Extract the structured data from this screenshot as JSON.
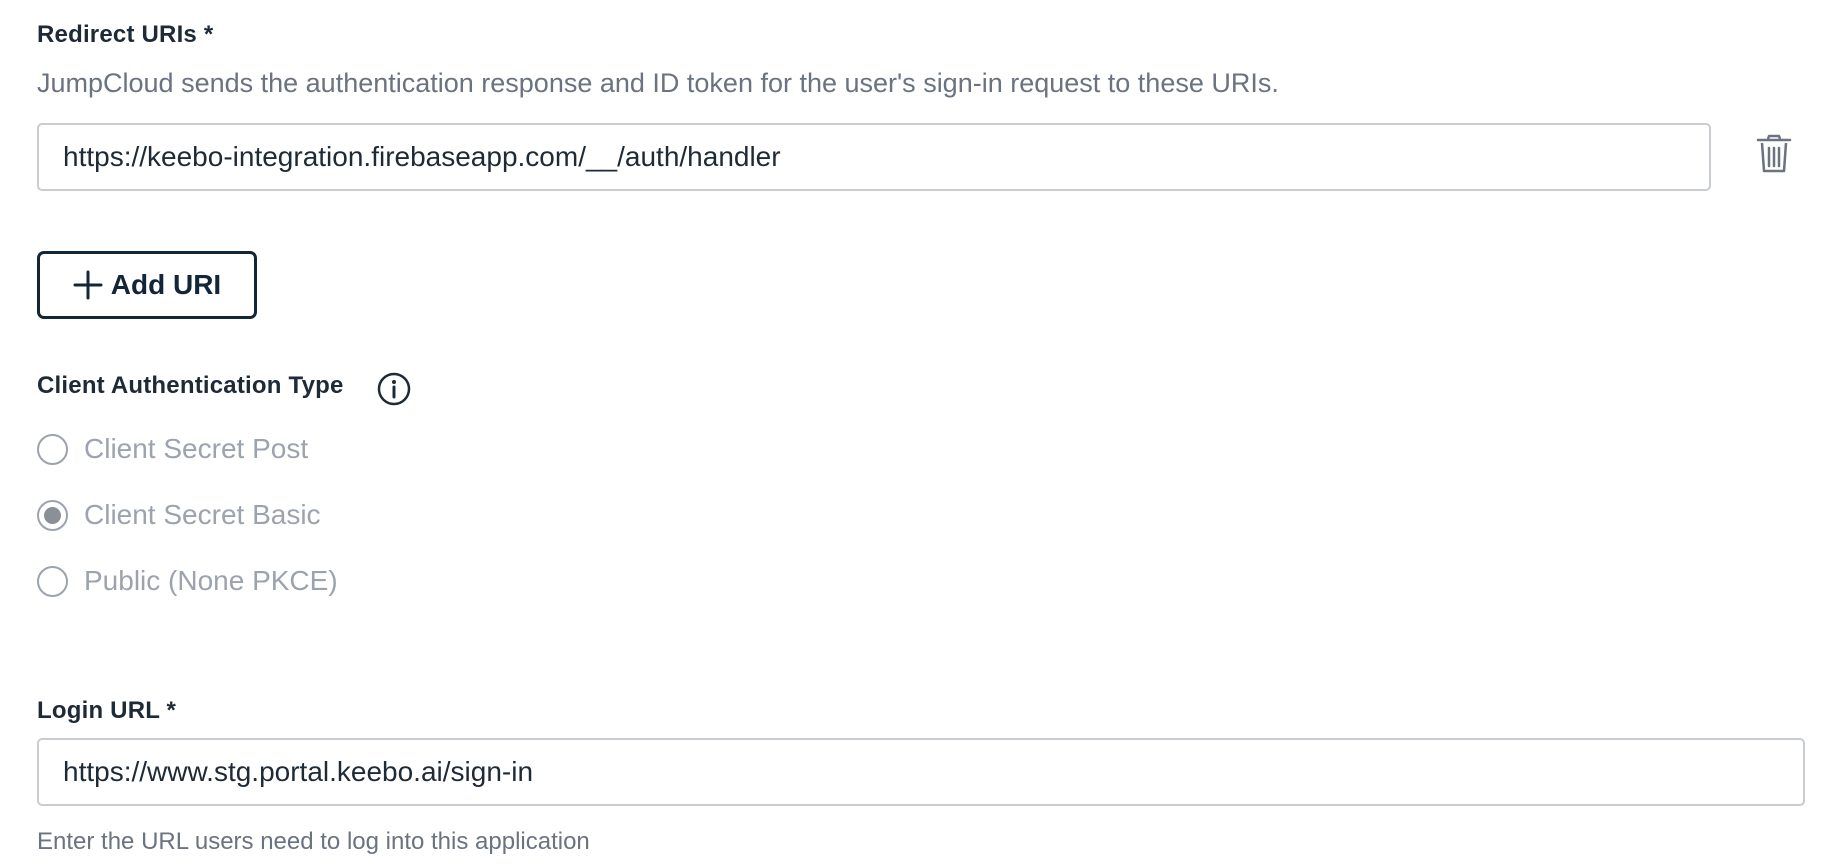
{
  "redirect": {
    "label": "Redirect URIs *",
    "description": "JumpCloud sends the authentication response and ID token for the user's sign-in request to these URIs.",
    "uri_value": "https://keebo-integration.firebaseapp.com/__/auth/handler",
    "delete_icon": "trash-icon",
    "add_button_label": "Add URI",
    "add_button_icon": "plus-icon"
  },
  "client_auth": {
    "label": "Client Authentication Type",
    "info_icon": "info-icon",
    "selected": "Client Secret Basic",
    "options": [
      {
        "label": "Client Secret Post",
        "checked": false
      },
      {
        "label": "Client Secret Basic",
        "checked": true
      },
      {
        "label": "Public (None PKCE)",
        "checked": false
      }
    ]
  },
  "login": {
    "label": "Login URL *",
    "value": "https://www.stg.portal.keebo.ai/sign-in",
    "helper": "Enter the URL users need to log into this application"
  },
  "colors": {
    "text": "#1f2a37",
    "muted": "#6b7280",
    "disabled": "#9ca3af",
    "input_border": "#c9ccd1",
    "button_border": "#12263a"
  }
}
